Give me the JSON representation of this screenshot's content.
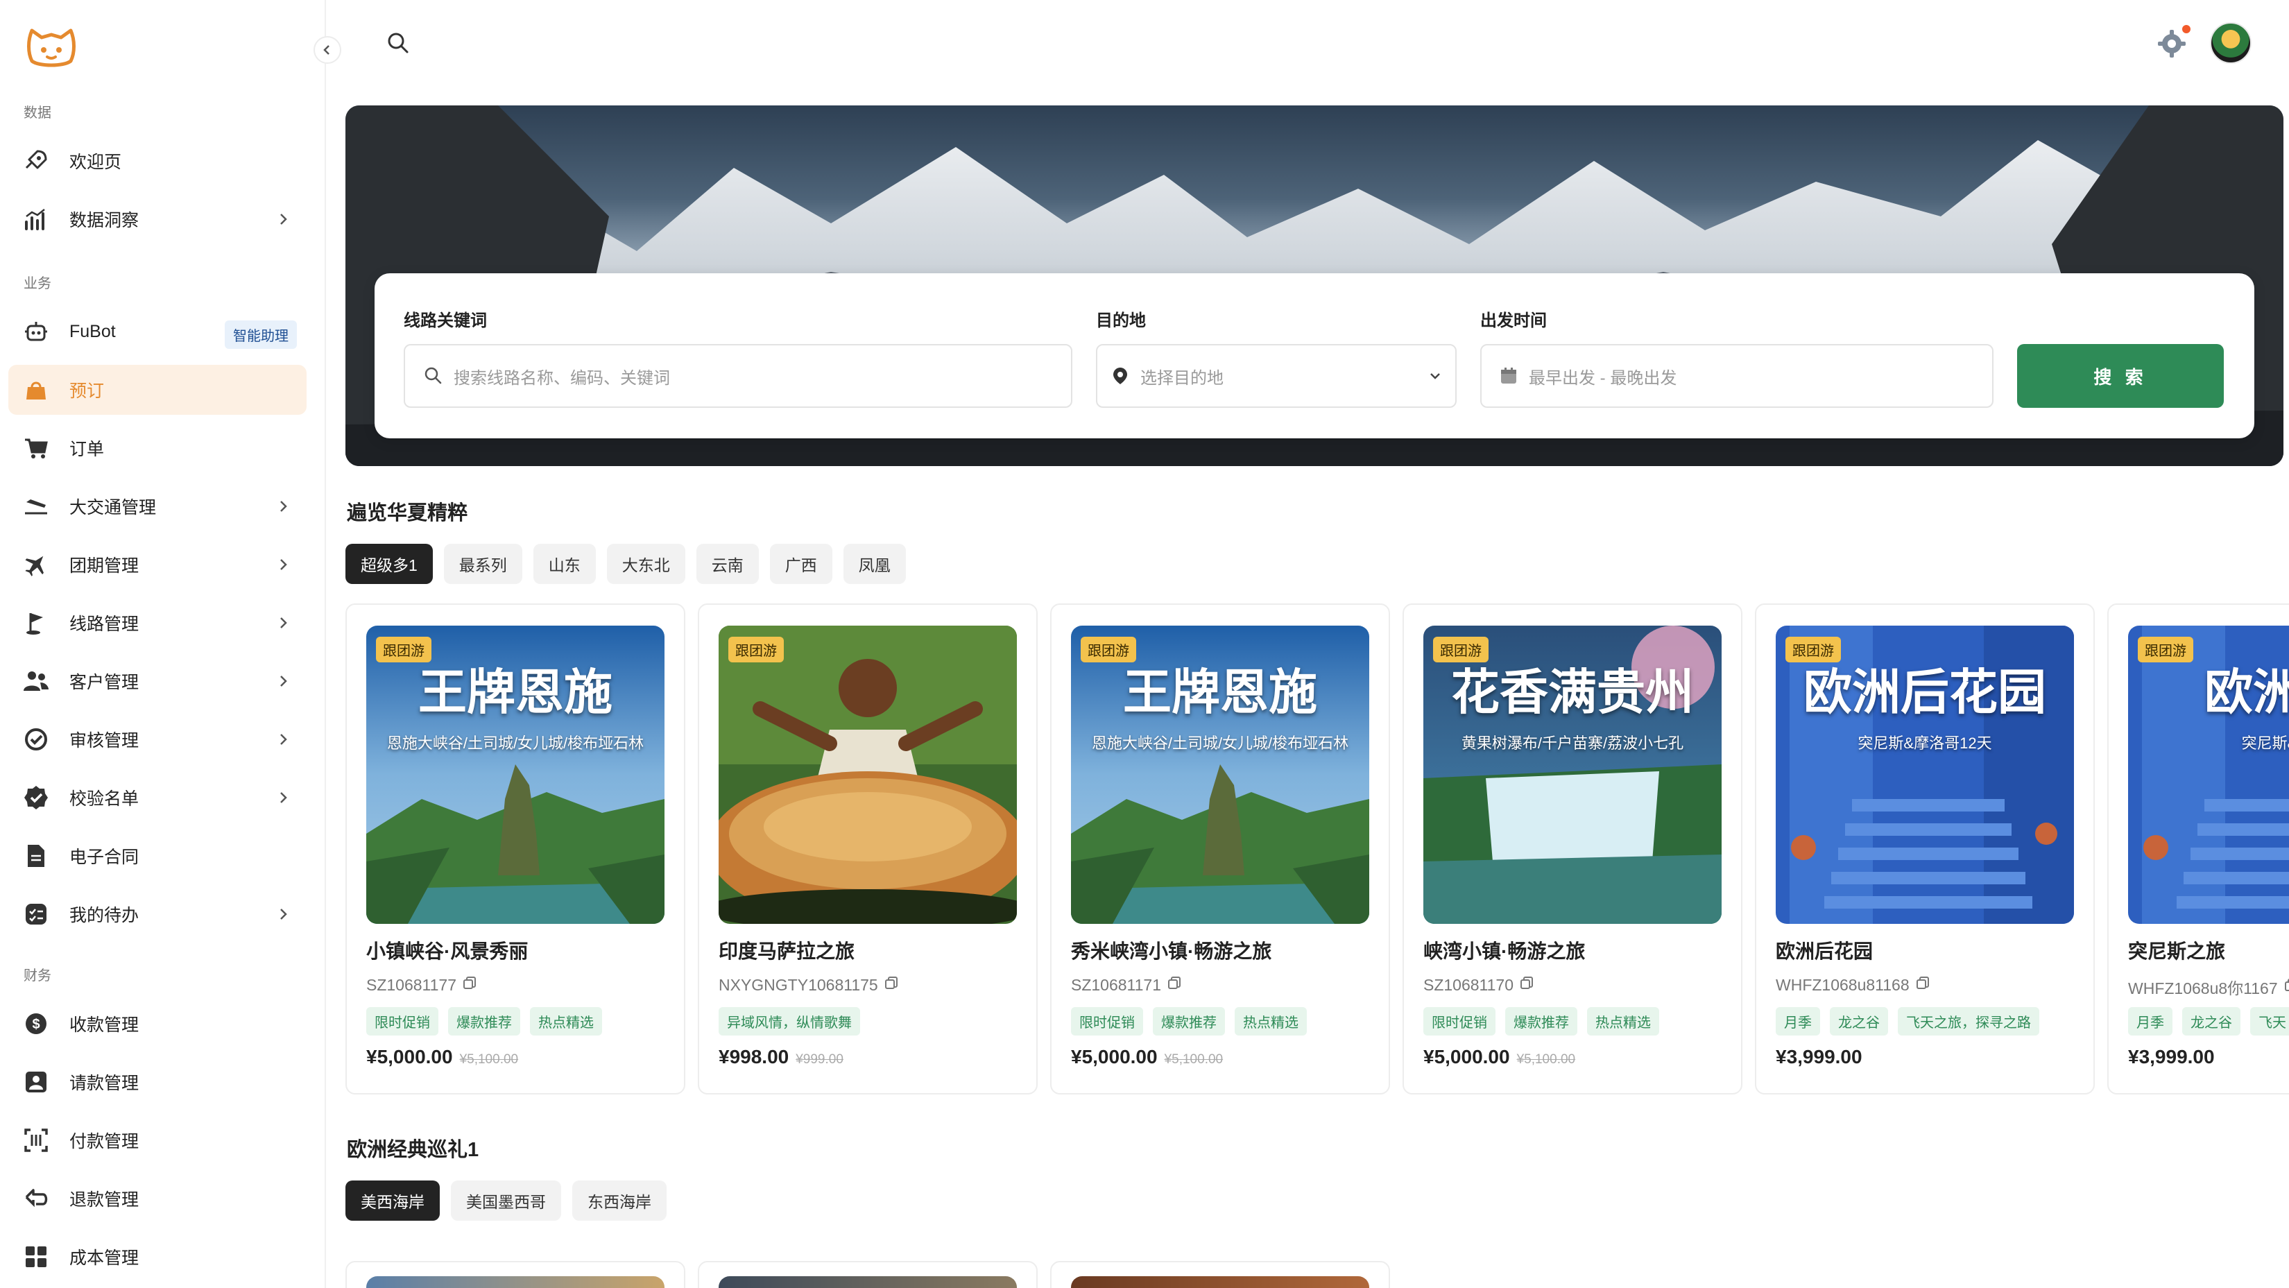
{
  "sidebar": {
    "sections": [
      {
        "label": "数据",
        "items": [
          {
            "label": "欢迎页",
            "icon": "rocket-icon",
            "expandable": false
          },
          {
            "label": "数据洞察",
            "icon": "chart-icon",
            "expandable": true
          }
        ]
      },
      {
        "label": "业务",
        "items": [
          {
            "label": "FuBot",
            "icon": "robot-icon",
            "badge": "智能助理",
            "expandable": false
          },
          {
            "label": "预订",
            "icon": "bag-icon",
            "active": true,
            "expandable": false
          },
          {
            "label": "订单",
            "icon": "cart-icon",
            "expandable": false
          },
          {
            "label": "大交通管理",
            "icon": "plane-land-icon",
            "expandable": true
          },
          {
            "label": "团期管理",
            "icon": "plane-icon",
            "expandable": true
          },
          {
            "label": "线路管理",
            "icon": "flag-icon",
            "expandable": true
          },
          {
            "label": "客户管理",
            "icon": "users-icon",
            "expandable": true
          },
          {
            "label": "审核管理",
            "icon": "audit-icon",
            "expandable": true
          },
          {
            "label": "校验名单",
            "icon": "check-badge-icon",
            "expandable": true
          },
          {
            "label": "电子合同",
            "icon": "document-icon",
            "expandable": false
          },
          {
            "label": "我的待办",
            "icon": "todo-icon",
            "expandable": true
          }
        ]
      },
      {
        "label": "财务",
        "items": [
          {
            "label": "收款管理",
            "icon": "dollar-icon",
            "expandable": false
          },
          {
            "label": "请款管理",
            "icon": "person-card-icon",
            "expandable": false
          },
          {
            "label": "付款管理",
            "icon": "scan-icon",
            "expandable": false
          },
          {
            "label": "退款管理",
            "icon": "refund-icon",
            "expandable": false
          },
          {
            "label": "成本管理",
            "icon": "grid-icon",
            "expandable": false
          }
        ]
      }
    ]
  },
  "search_panel": {
    "keyword_label": "线路关键词",
    "keyword_placeholder": "搜索线路名称、编码、关键词",
    "destination_label": "目的地",
    "destination_placeholder": "选择目的地",
    "date_label": "出发时间",
    "date_placeholder": "最早出发 - 最晚出发",
    "button_label": "搜 索"
  },
  "section1": {
    "title": "遍览华夏精粹",
    "tabs": [
      "超级多1",
      "最系列",
      "山东",
      "大东北",
      "云南",
      "广西",
      "凤凰"
    ],
    "active_tab": 0,
    "cards": [
      {
        "badge": "跟团游",
        "thumb_title": "王牌恩施",
        "thumb_sub": "恩施大峡谷/土司城/女儿城/梭布垭石林",
        "name": "小镇峡谷·风景秀丽",
        "code": "SZ10681177",
        "tags": [
          "限时促销",
          "爆款推荐",
          "热点精选"
        ],
        "price": "¥5,000.00",
        "original_price": "¥5,100.00",
        "theme": "mountain"
      },
      {
        "badge": "跟团游",
        "thumb_title": "",
        "thumb_sub": "",
        "name": "印度马萨拉之旅",
        "code": "NXYGNGTY10681175",
        "tags": [
          "异域风情，纵情歌舞"
        ],
        "price": "¥998.00",
        "original_price": "¥999.00",
        "theme": "food"
      },
      {
        "badge": "跟团游",
        "thumb_title": "王牌恩施",
        "thumb_sub": "恩施大峡谷/土司城/女儿城/梭布垭石林",
        "name": "秀米峡湾小镇·畅游之旅",
        "code": "SZ10681171",
        "tags": [
          "限时促销",
          "爆款推荐",
          "热点精选"
        ],
        "price": "¥5,000.00",
        "original_price": "¥5,100.00",
        "theme": "mountain"
      },
      {
        "badge": "跟团游",
        "thumb_title": "花香满贵州",
        "thumb_sub": "黄果树瀑布/千户苗寨/荔波小七孔",
        "name": "峡湾小镇·畅游之旅",
        "code": "SZ10681170",
        "tags": [
          "限时促销",
          "爆款推荐",
          "热点精选"
        ],
        "price": "¥5,000.00",
        "original_price": "¥5,100.00",
        "theme": "waterfall"
      },
      {
        "badge": "跟团游",
        "thumb_title": "欧洲后花园",
        "thumb_sub": "突尼斯&摩洛哥12天",
        "name": "欧洲后花园",
        "code": "WHFZ1068u81168",
        "tags": [
          "月季",
          "龙之谷",
          "飞天之旅，探寻之路"
        ],
        "price": "¥3,999.00",
        "original_price": "",
        "theme": "blue"
      },
      {
        "badge": "跟团游",
        "thumb_title": "欧洲后",
        "thumb_sub": "突尼斯&摩",
        "name": "突尼斯之旅",
        "code": "WHFZ1068u8你1167",
        "tags": [
          "月季",
          "龙之谷",
          "飞天"
        ],
        "price": "¥3,999.00",
        "original_price": "",
        "theme": "blue"
      }
    ]
  },
  "section2": {
    "title": "欧洲经典巡礼1",
    "tabs": [
      "美西海岸",
      "美国墨西哥",
      "东西海岸"
    ],
    "active_tab": 0
  },
  "colors": {
    "accent_green": "#2e8b57",
    "active_orange": "#e58a2e",
    "active_bg": "#fdf0e3",
    "badge_yellow": "#f3c24d"
  }
}
